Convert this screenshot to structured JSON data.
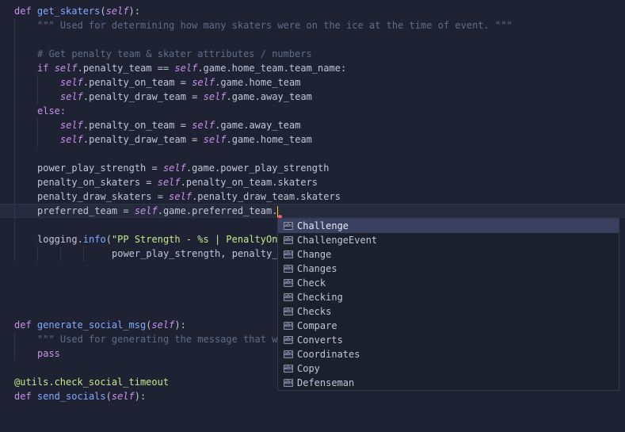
{
  "colors": {
    "background": "#1f2233",
    "keyword": "#c792ea",
    "function": "#82aaff",
    "string": "#c3e88d",
    "comment": "#5f6d88",
    "caret": "#ffcc00",
    "popup_selected": "#3a4160"
  },
  "code": {
    "l1_def": "def",
    "l1_name": "get_skaters",
    "l1_open": "(",
    "l1_self": "self",
    "l1_close": "):",
    "l2_doc": "\"\"\" Used for determining how many skaters were on the ice at the time of event. \"\"\"",
    "l4_comment": "# Get penalty team & skater attributes / numbers",
    "l5_if": "if",
    "l5_self1": "self",
    "l5_mid": ".penalty_team == ",
    "l5_self2": "self",
    "l5_end": ".game.home_team.team_name:",
    "l6_self1": "self",
    "l6_mid": ".penalty_on_team = ",
    "l6_self2": "self",
    "l6_end": ".game.home_team",
    "l7_self1": "self",
    "l7_mid": ".penalty_draw_team = ",
    "l7_self2": "self",
    "l7_end": ".game.away_team",
    "l8_else": "else:",
    "l9_self1": "self",
    "l9_mid": ".penalty_on_team = ",
    "l9_self2": "self",
    "l9_end": ".game.away_team",
    "l10_self1": "self",
    "l10_mid": ".penalty_draw_team = ",
    "l10_self2": "self",
    "l10_end": ".game.home_team",
    "l12_start": "power_play_strength = ",
    "l12_self": "self",
    "l12_end": ".game.power_play_strength",
    "l13_start": "penalty_on_skaters = ",
    "l13_self": "self",
    "l13_end": ".penalty_on_team.skaters",
    "l14_start": "penalty_draw_skaters = ",
    "l14_self": "self",
    "l14_end": ".penalty_draw_team.skaters",
    "l15_start": "preferred_team = ",
    "l15_self": "self",
    "l15_end": ".game.preferred_team.",
    "l17_start": "logging.",
    "l17_fn": "info",
    "l17_open": "(",
    "l17_str": "\"PP Strength - %s | PenaltyOn",
    "l18_text": "power_play_strength, penalty_",
    "l23_def": "def",
    "l23_name": "generate_social_msg",
    "l23_open": "(",
    "l23_self": "self",
    "l23_close": "):",
    "l24_doc": "\"\"\" Used for generating the message that w",
    "l25_pass": "pass",
    "l27_decorator": "@utils.check_social_timeout",
    "l28_def": "def",
    "l28_name": "send_socials",
    "l28_open": "(",
    "l28_self": "self",
    "l28_close": "):"
  },
  "autocomplete": {
    "kind_badge": "abc",
    "items": [
      "Challenge",
      "ChallengeEvent",
      "Change",
      "Changes",
      "Check",
      "Checking",
      "Checks",
      "Compare",
      "Converts",
      "Coordinates",
      "Copy",
      "Defenseman"
    ],
    "selected": "Challenge"
  }
}
